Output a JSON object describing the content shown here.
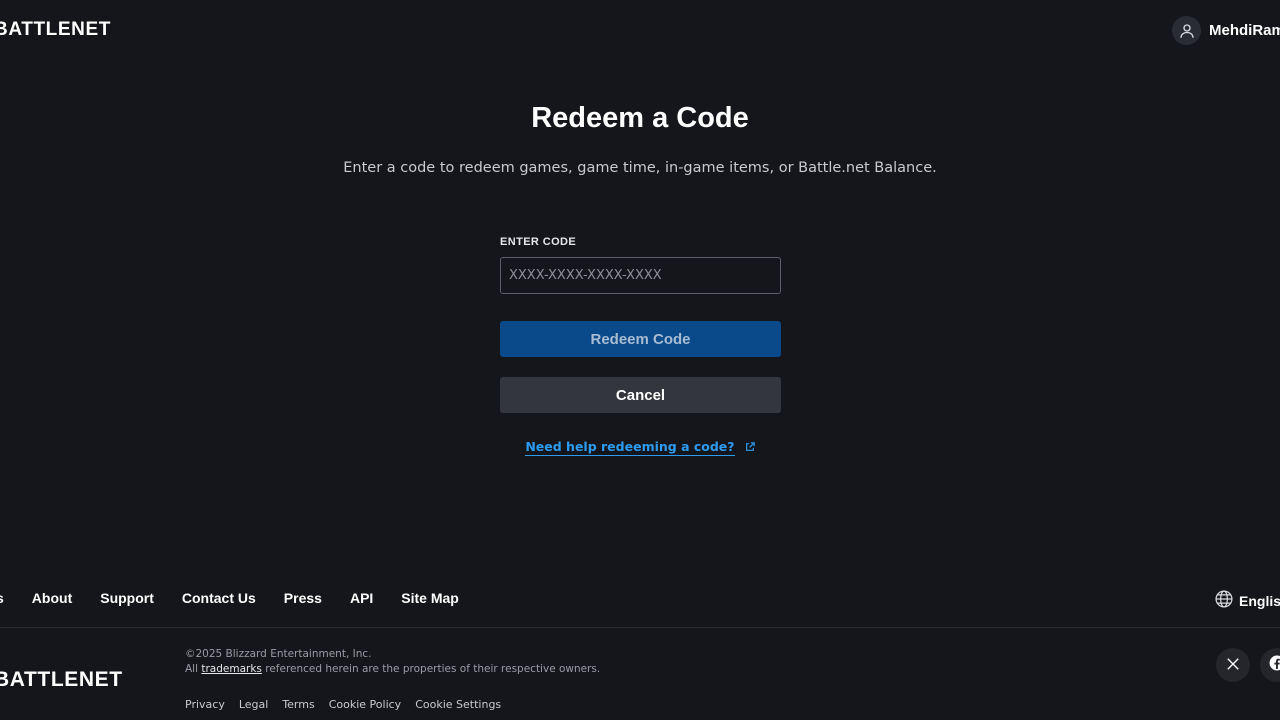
{
  "header": {
    "logo_text": "BATTLENET",
    "account_name": "MehdiRam"
  },
  "main": {
    "title": "Redeem a Code",
    "subtitle": "Enter a code to redeem games, game time, in-game items, or Battle.net Balance.",
    "field_label": "ENTER CODE",
    "code_placeholder": "XXXX-XXXX-XXXX-XXXX",
    "code_value": "",
    "redeem_label": "Redeem Code",
    "cancel_label": "Cancel",
    "help_link_label": "Need help redeeming a code?"
  },
  "footer_nav": {
    "partial_first": "s",
    "items": [
      "About",
      "Support",
      "Contact Us",
      "Press",
      "API",
      "Site Map"
    ],
    "language": "English"
  },
  "footer": {
    "logo_text": "BATTLENET",
    "copyright": "©2025 Blizzard Entertainment, Inc.",
    "trademark_prefix": "All",
    "trademark_link": "trademarks",
    "trademark_suffix": "referenced herein are the properties of their respective owners.",
    "legal_links": [
      "Privacy",
      "Legal",
      "Terms",
      "Cookie Policy",
      "Cookie Settings"
    ]
  },
  "colors": {
    "background": "#15161b",
    "primary_button": "#0a4a8a",
    "secondary_button": "#34363d",
    "link": "#2d9bf0"
  }
}
